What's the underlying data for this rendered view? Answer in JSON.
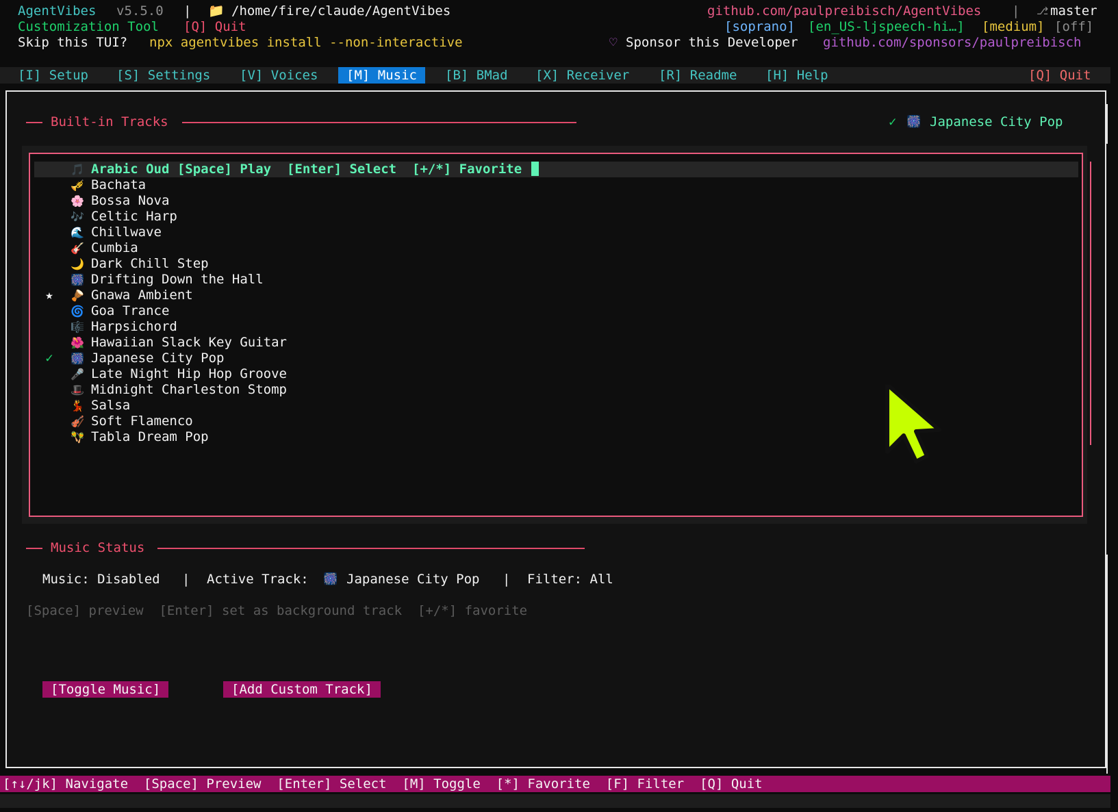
{
  "header": {
    "app_name": "AgentVibes",
    "version": "v5.5.0",
    "separator": "|",
    "folder_icon": "folder-icon",
    "path": "/home/fire/claude/AgentVibes",
    "repo": "github.com/paulpreibisch/AgentVibes",
    "branch_icon": "branch-icon",
    "branch": "master",
    "subtitle": "Customization Tool",
    "quit_hint": "[Q] Quit",
    "status_voice": "[soprano]",
    "status_model": "[en_US-ljspeech-hi…]",
    "status_quality": "[medium]",
    "status_off": "[off]",
    "skip_label": "Skip this TUI?",
    "skip_command": "npx agentvibes install --non-interactive",
    "heart": "♡",
    "sponsor_label": "Sponsor this Developer",
    "sponsor_url": "github.com/sponsors/paulpreibisch"
  },
  "tabs": [
    {
      "label": "[I] Setup"
    },
    {
      "label": "[S] Settings"
    },
    {
      "label": "[V] Voices"
    },
    {
      "label": "[M] Music"
    },
    {
      "label": "[B] BMad"
    },
    {
      "label": "[X] Receiver"
    },
    {
      "label": "[R] Readme"
    },
    {
      "label": "[H] Help"
    }
  ],
  "tab_quit": "[Q] Quit",
  "tracks_section": {
    "title": "Built-in Tracks",
    "active_check": "✓",
    "active_icon": "🎆",
    "active_name": "Japanese City Pop"
  },
  "tracks": [
    {
      "mark": "",
      "icon": "🎵",
      "name": "Arabic Oud",
      "hint": " [Space] Play  [Enter] Select  [+/*] Favorite"
    },
    {
      "mark": "",
      "icon": "🎺",
      "name": "Bachata"
    },
    {
      "mark": "",
      "icon": "🌸",
      "name": "Bossa Nova"
    },
    {
      "mark": "",
      "icon": "🎶",
      "name": "Celtic Harp"
    },
    {
      "mark": "",
      "icon": "🌊",
      "name": "Chillwave"
    },
    {
      "mark": "",
      "icon": "🎸",
      "name": "Cumbia"
    },
    {
      "mark": "",
      "icon": "🌙",
      "name": "Dark Chill Step"
    },
    {
      "mark": "",
      "icon": "🎆",
      "name": "Drifting Down the Hall"
    },
    {
      "mark": "★",
      "icon": "🪘",
      "name": "Gnawa Ambient"
    },
    {
      "mark": "",
      "icon": "🌀",
      "name": "Goa Trance"
    },
    {
      "mark": "",
      "icon": "🎼",
      "name": "Harpsichord"
    },
    {
      "mark": "",
      "icon": "🌺",
      "name": "Hawaiian Slack Key Guitar"
    },
    {
      "mark": "✓",
      "icon": "🎆",
      "name": "Japanese City Pop"
    },
    {
      "mark": "",
      "icon": "🎤",
      "name": "Late Night Hip Hop Groove"
    },
    {
      "mark": "",
      "icon": "🎩",
      "name": "Midnight Charleston Stomp"
    },
    {
      "mark": "",
      "icon": "💃",
      "name": "Salsa"
    },
    {
      "mark": "",
      "icon": "🎻",
      "name": "Soft Flamenco"
    },
    {
      "mark": "",
      "icon": "🪇",
      "name": "Tabla Dream Pop"
    }
  ],
  "status_section": {
    "title": "Music Status",
    "music_label": "Music: Disabled",
    "sep": "|",
    "active_label": "Active Track:",
    "active_icon": "🎆",
    "active_name": "Japanese City Pop",
    "filter_label": "Filter: All",
    "help_line": "[Space] preview  [Enter] set as background track  [+/*] favorite"
  },
  "buttons": {
    "toggle": "[Toggle Music]",
    "add_custom": "[Add Custom Track]"
  },
  "statusbar": "[↑↓/jk] Navigate  [Space] Preview  [Enter] Select  [M] Toggle  [*] Favorite  [F] Filter  [Q] Quit",
  "colors": {
    "accent": "#45c6c4",
    "active_tab": "#0e7ad6",
    "section": "#f0506e",
    "button_bg": "#9a0e62",
    "highlight": "#5ff2b4",
    "pointer": "#c6ff00"
  }
}
